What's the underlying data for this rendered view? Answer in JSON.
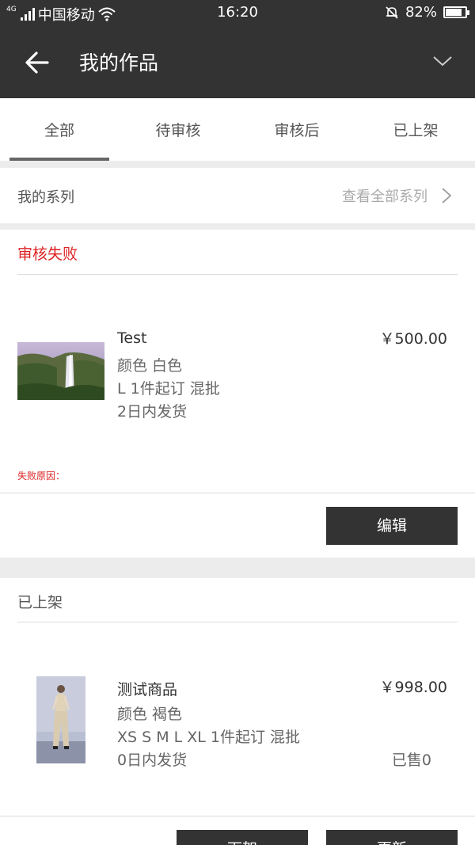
{
  "status_bar": {
    "network_tag": "4G",
    "carrier": "中国移动",
    "time": "16:20",
    "battery_percent": "82%",
    "battery_level": 0.82
  },
  "header": {
    "title": "我的作品"
  },
  "tabs": [
    {
      "label": "全部",
      "active": true
    },
    {
      "label": "待审核",
      "active": false
    },
    {
      "label": "审核后",
      "active": false
    },
    {
      "label": "已上架",
      "active": false
    }
  ],
  "series": {
    "label": "我的系列",
    "link_label": "查看全部系列"
  },
  "sections": [
    {
      "heading": "审核失败",
      "heading_color": "#dd2222",
      "product": {
        "name": "Test",
        "color": "颜色 白色",
        "order": "L 1件起订 混批",
        "shipping": "2日内发货",
        "price": "￥500.00",
        "image": "waterfall-landscape"
      },
      "fail_reason_label": "失败原因：",
      "button_label": "编辑"
    },
    {
      "heading": "已上架",
      "heading_color": "#555555",
      "product": {
        "name": "测试商品",
        "color": "颜色 褐色",
        "order": "XS S M L XL 1件起订 混批",
        "shipping": "0日内发货",
        "price": "￥998.00",
        "sold": "已售0",
        "image": "fashion-model"
      },
      "buttons": [
        "下架",
        "更新"
      ]
    }
  ]
}
